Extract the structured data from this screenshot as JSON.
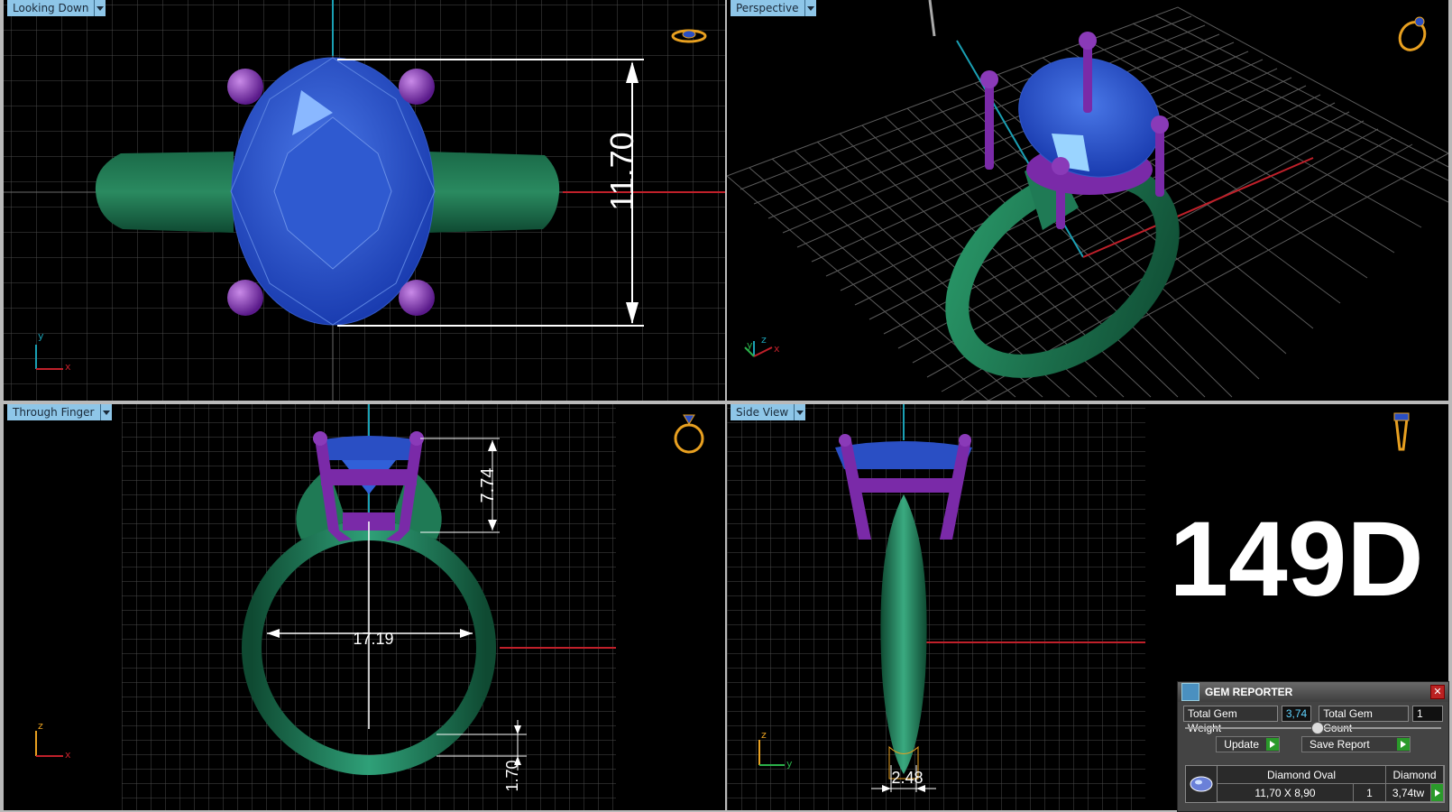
{
  "viewports": {
    "top_left": {
      "label": "Looking Down",
      "dimension": "11.70",
      "axes": [
        "y",
        "x"
      ]
    },
    "top_right": {
      "label": "Perspective",
      "axes": [
        "z",
        "y",
        "x"
      ]
    },
    "bottom_left": {
      "label": "Through Finger",
      "dim_height": "7.74",
      "dim_width": "17.19",
      "dim_shank": "1.70",
      "axes": [
        "z",
        "x"
      ]
    },
    "bottom_right": {
      "label": "Side View",
      "dim_shank": "2.48",
      "axes": [
        "z",
        "y"
      ]
    }
  },
  "model_code": "149D",
  "gem_reporter": {
    "title": "GEM REPORTER",
    "total_weight_label": "Total Gem Weight",
    "total_weight_value": "3,74",
    "total_count_label": "Total Gem Count",
    "total_count_value": "1",
    "update_label": "Update",
    "save_label": "Save Report",
    "row": {
      "name": "Diamond Oval",
      "type": "Diamond",
      "size": "11,70 X 8,90",
      "count": "1",
      "weight": "3,74tw"
    }
  },
  "colors": {
    "band": "#1f7a55",
    "gem": "#2a4fc4",
    "prong": "#7a2aa8",
    "grid": "#5a5a5a",
    "dimension": "#ffffff",
    "axis_red": "#c0202a",
    "axis_cyan": "#1aa0b4",
    "icon": "#e8a020"
  }
}
